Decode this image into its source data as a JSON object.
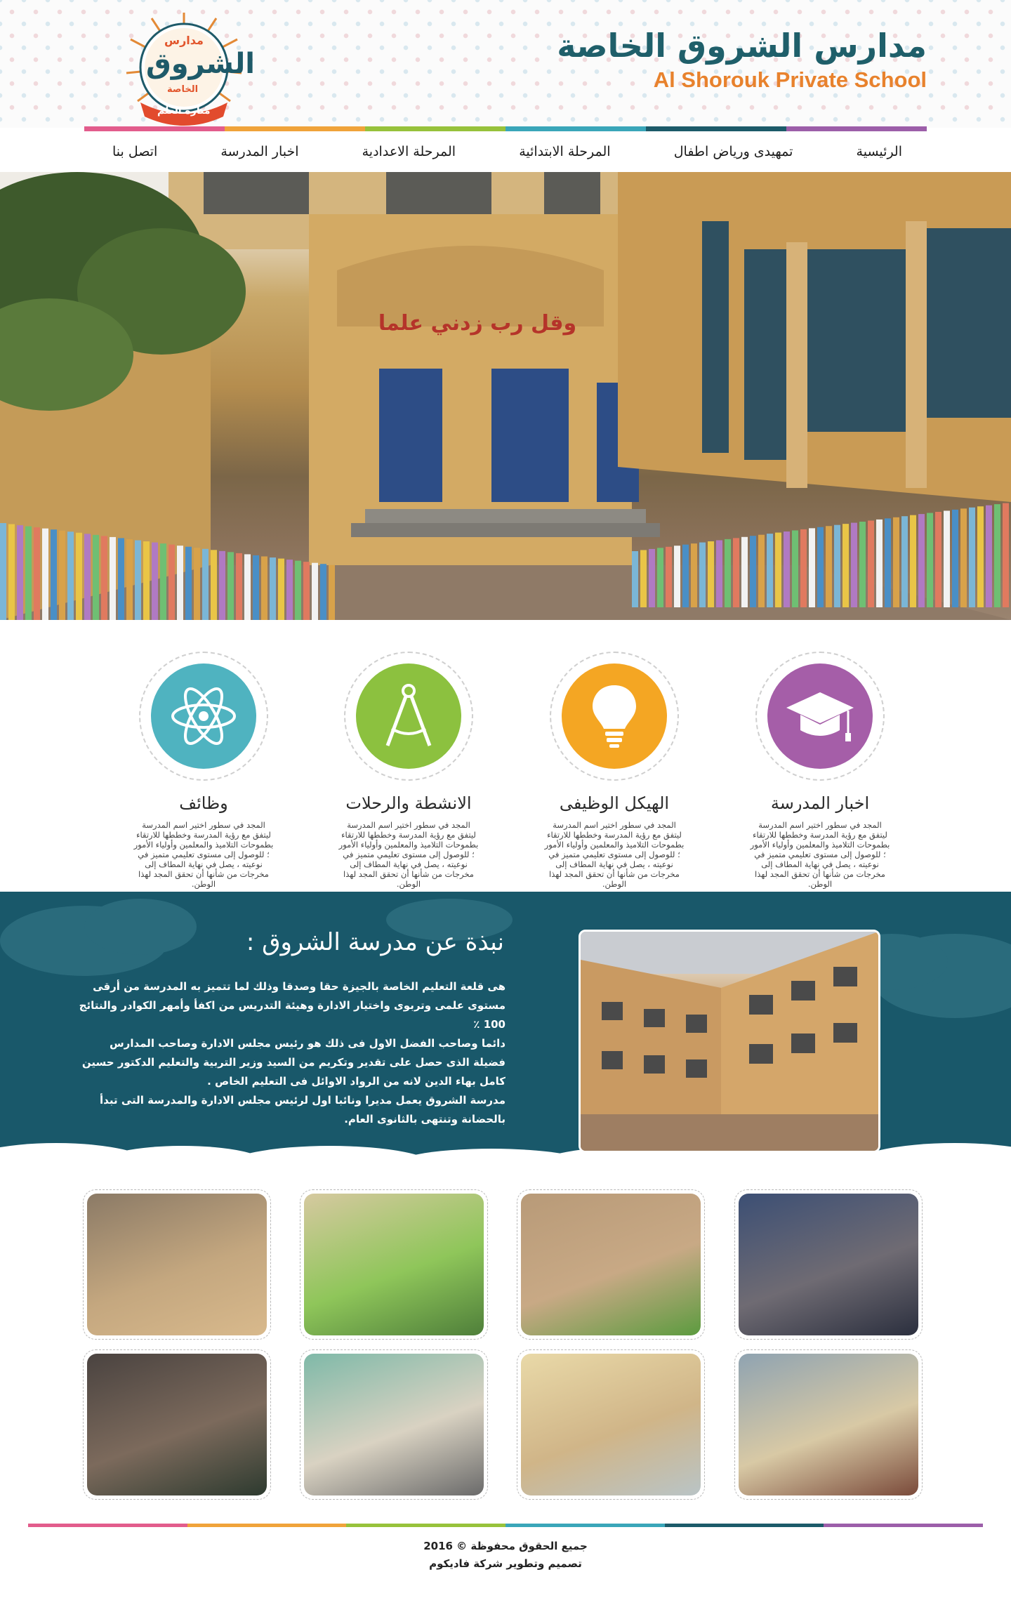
{
  "header": {
    "school_name_ar": "مدارس الشروق الخاصة",
    "school_name_en": "Al Shorouk Private School",
    "logo": {
      "top_text": "مدارس",
      "main_text": "الشروق",
      "ribbon_text": "الخاصة",
      "bottom_text": "منارة العلم"
    },
    "colors": [
      "#e25c8c",
      "#f0a33a",
      "#97c23b",
      "#3aa6b9",
      "#1c5a69",
      "#9c5ea9"
    ]
  },
  "nav": {
    "items": [
      {
        "label": "الرئيسية"
      },
      {
        "label": "تمهيدى ورياض اطفال"
      },
      {
        "label": "المرحلة الابتدائية"
      },
      {
        "label": "المرحلة الاعدادية"
      },
      {
        "label": "اخبار المدرسة"
      },
      {
        "label": "اتصل بنا"
      }
    ]
  },
  "hero": {
    "sign_text": "وقل رب زدني علما"
  },
  "features": [
    {
      "title": "اخبار المدرسة",
      "icon": "graduation-cap-icon",
      "color": "#a55ea8",
      "description": "المجد في سطور اختير اسم المدرسة ليتفق مع رؤية المدرسة وخططها للارتقاء بطموحات التلاميذ والمعلمين وأولياء الأمور ؛ للوصول إلى مستوى تعليمي متميز في نوعيته ، يصل في نهاية المطاف إلى مخرجات من شأنها أن تحقق المجد لهذا الوطن."
    },
    {
      "title": "الهيكل الوظيفى",
      "icon": "light-bulb-icon",
      "color": "#f4a623",
      "description": "المجد في سطور اختير اسم المدرسة ليتفق مع رؤية المدرسة وخططها للارتقاء بطموحات التلاميذ والمعلمين وأولياء الأمور ؛ للوصول إلى مستوى تعليمي متميز في نوعيته ، يصل في نهاية المطاف إلى مخرجات من شأنها أن تحقق المجد لهذا الوطن."
    },
    {
      "title": "الانشطة والرحلات",
      "icon": "compass-icon",
      "color": "#8cc13f",
      "description": "المجد في سطور اختير اسم المدرسة ليتفق مع رؤية المدرسة وخططها للارتقاء بطموحات التلاميذ والمعلمين وأولياء الأمور ؛ للوصول إلى مستوى تعليمي متميز في نوعيته ، يصل في نهاية المطاف إلى مخرجات من شأنها أن تحقق المجد لهذا الوطن."
    },
    {
      "title": "وظائف",
      "icon": "atom-icon",
      "color": "#4fb3c0",
      "description": "المجد في سطور اختير اسم المدرسة ليتفق مع رؤية المدرسة وخططها للارتقاء بطموحات التلاميذ والمعلمين وأولياء الأمور ؛ للوصول إلى مستوى تعليمي متميز في نوعيته ، يصل في نهاية المطاف إلى مخرجات من شأنها أن تحقق المجد لهذا الوطن."
    }
  ],
  "about": {
    "title": "نبذة عن مدرسة الشروق :",
    "paragraphs": [
      "هى قلعة التعليم الخاصة بالجيزة حقا وصدقا وذلك لما تتميز به المدرسة من أرقى مستوى علمى وتربوى واختيار الادارة وهيئة التدريس من اكفأ وأمهر الكوادر والنتائج 100 ٪",
      "دائما وصاحب الفضل الاول فى ذلك هو رئيس مجلس الادارة وصاحب المدارس فضيلة الذى حصل على تقدير وتكريم من السيد وزير التربية والتعليم الدكتور حسين كامل بهاء الدين لانه من الرواد الاوائل فى التعليم الخاص .",
      "مدرسة الشروق يعمل مديرا ونائبا اول لرئيس مجلس الادارة والمدرسة التى تبدأ بالحضانة وتنتهى بالثانوى العام."
    ]
  },
  "gallery": {
    "photos": [
      {
        "name": "school-yard-photo",
        "colors": [
          "#8b7a66",
          "#c4a77f",
          "#d8b98c"
        ]
      },
      {
        "name": "class-group-photo",
        "colors": [
          "#d6c9a0",
          "#8fc65a",
          "#4f7f3a"
        ]
      },
      {
        "name": "circle-activity-photo",
        "colors": [
          "#b89a78",
          "#c8a985",
          "#5c9b3f"
        ]
      },
      {
        "name": "playground-kids-photo",
        "colors": [
          "#3c4f74",
          "#6f6b73",
          "#2b2f3e"
        ]
      },
      {
        "name": "art-class-photo",
        "colors": [
          "#4a4340",
          "#7c6a5c",
          "#2d3a2f"
        ]
      },
      {
        "name": "quran-class-photo",
        "colors": [
          "#7fb9a8",
          "#d9d2c2",
          "#6a6a6a"
        ]
      },
      {
        "name": "computer-lab-photo",
        "colors": [
          "#e9d9a8",
          "#d0b588",
          "#b9c4c6"
        ]
      },
      {
        "name": "classroom-photo",
        "colors": [
          "#8fa3b1",
          "#d8c9a5",
          "#7a4a3a"
        ]
      }
    ]
  },
  "footer": {
    "copyright": "جميع الحقوق محفوظة © 2016",
    "credit": "تصميم وتطوير شركة فاديكوم"
  }
}
